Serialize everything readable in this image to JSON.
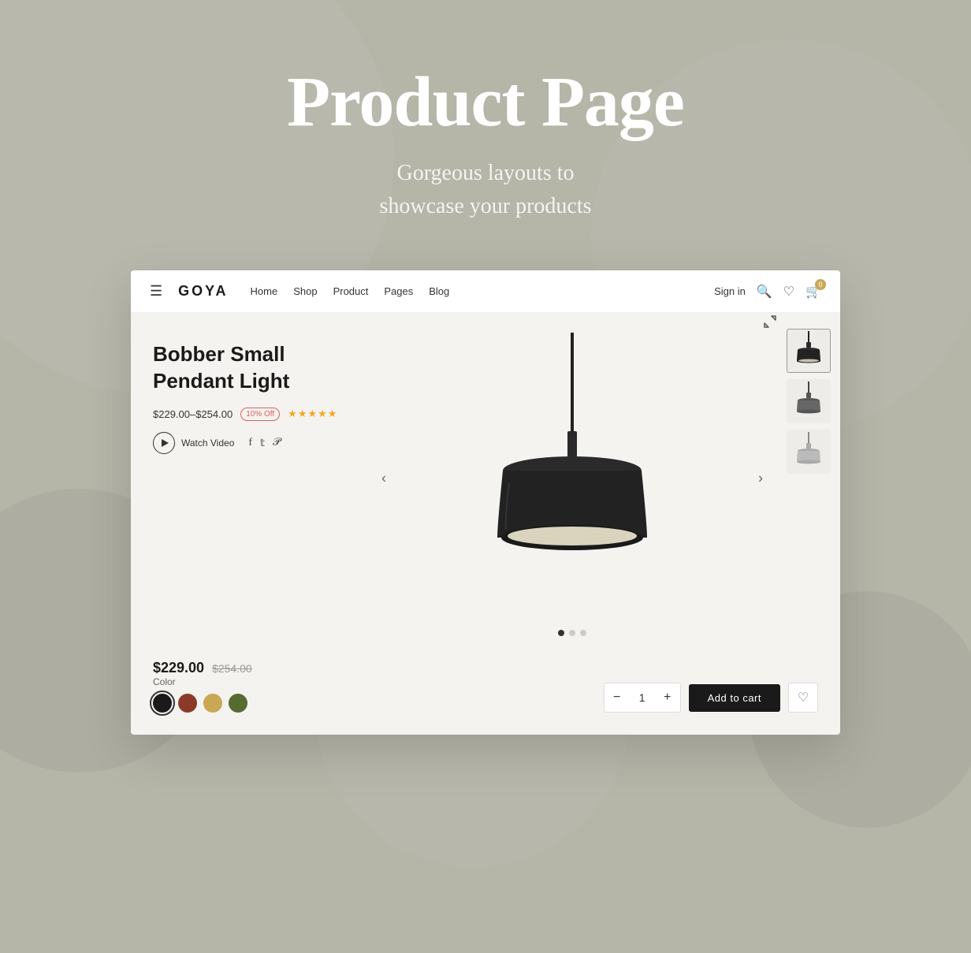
{
  "page": {
    "background_color": "#b5b5a8",
    "hero": {
      "title": "Product Page",
      "subtitle_line1": "Gorgeous layouts to",
      "subtitle_line2": "showcase your products"
    },
    "navbar": {
      "logo": "GOYA",
      "links": [
        "Home",
        "Shop",
        "Product",
        "Pages",
        "Blog"
      ],
      "signin": "Sign in",
      "cart_count": "0"
    },
    "product": {
      "name": "Bobber Small Pendant Light",
      "price_range": "$229.00–$254.00",
      "discount": "10% Off",
      "current_price": "$229.00",
      "original_price": "$254.00",
      "stars": "★★★★★",
      "watch_video": "Watch Video",
      "color_label": "Color",
      "colors": [
        "#1a1a1a",
        "#8b3a2a",
        "#c8a855",
        "#556b2f"
      ],
      "quantity": "1",
      "add_to_cart": "Add to cart"
    },
    "carousel": {
      "dots": 3,
      "active_dot": 0
    },
    "social": {
      "icons": [
        "f",
        "t",
        "p"
      ]
    }
  }
}
